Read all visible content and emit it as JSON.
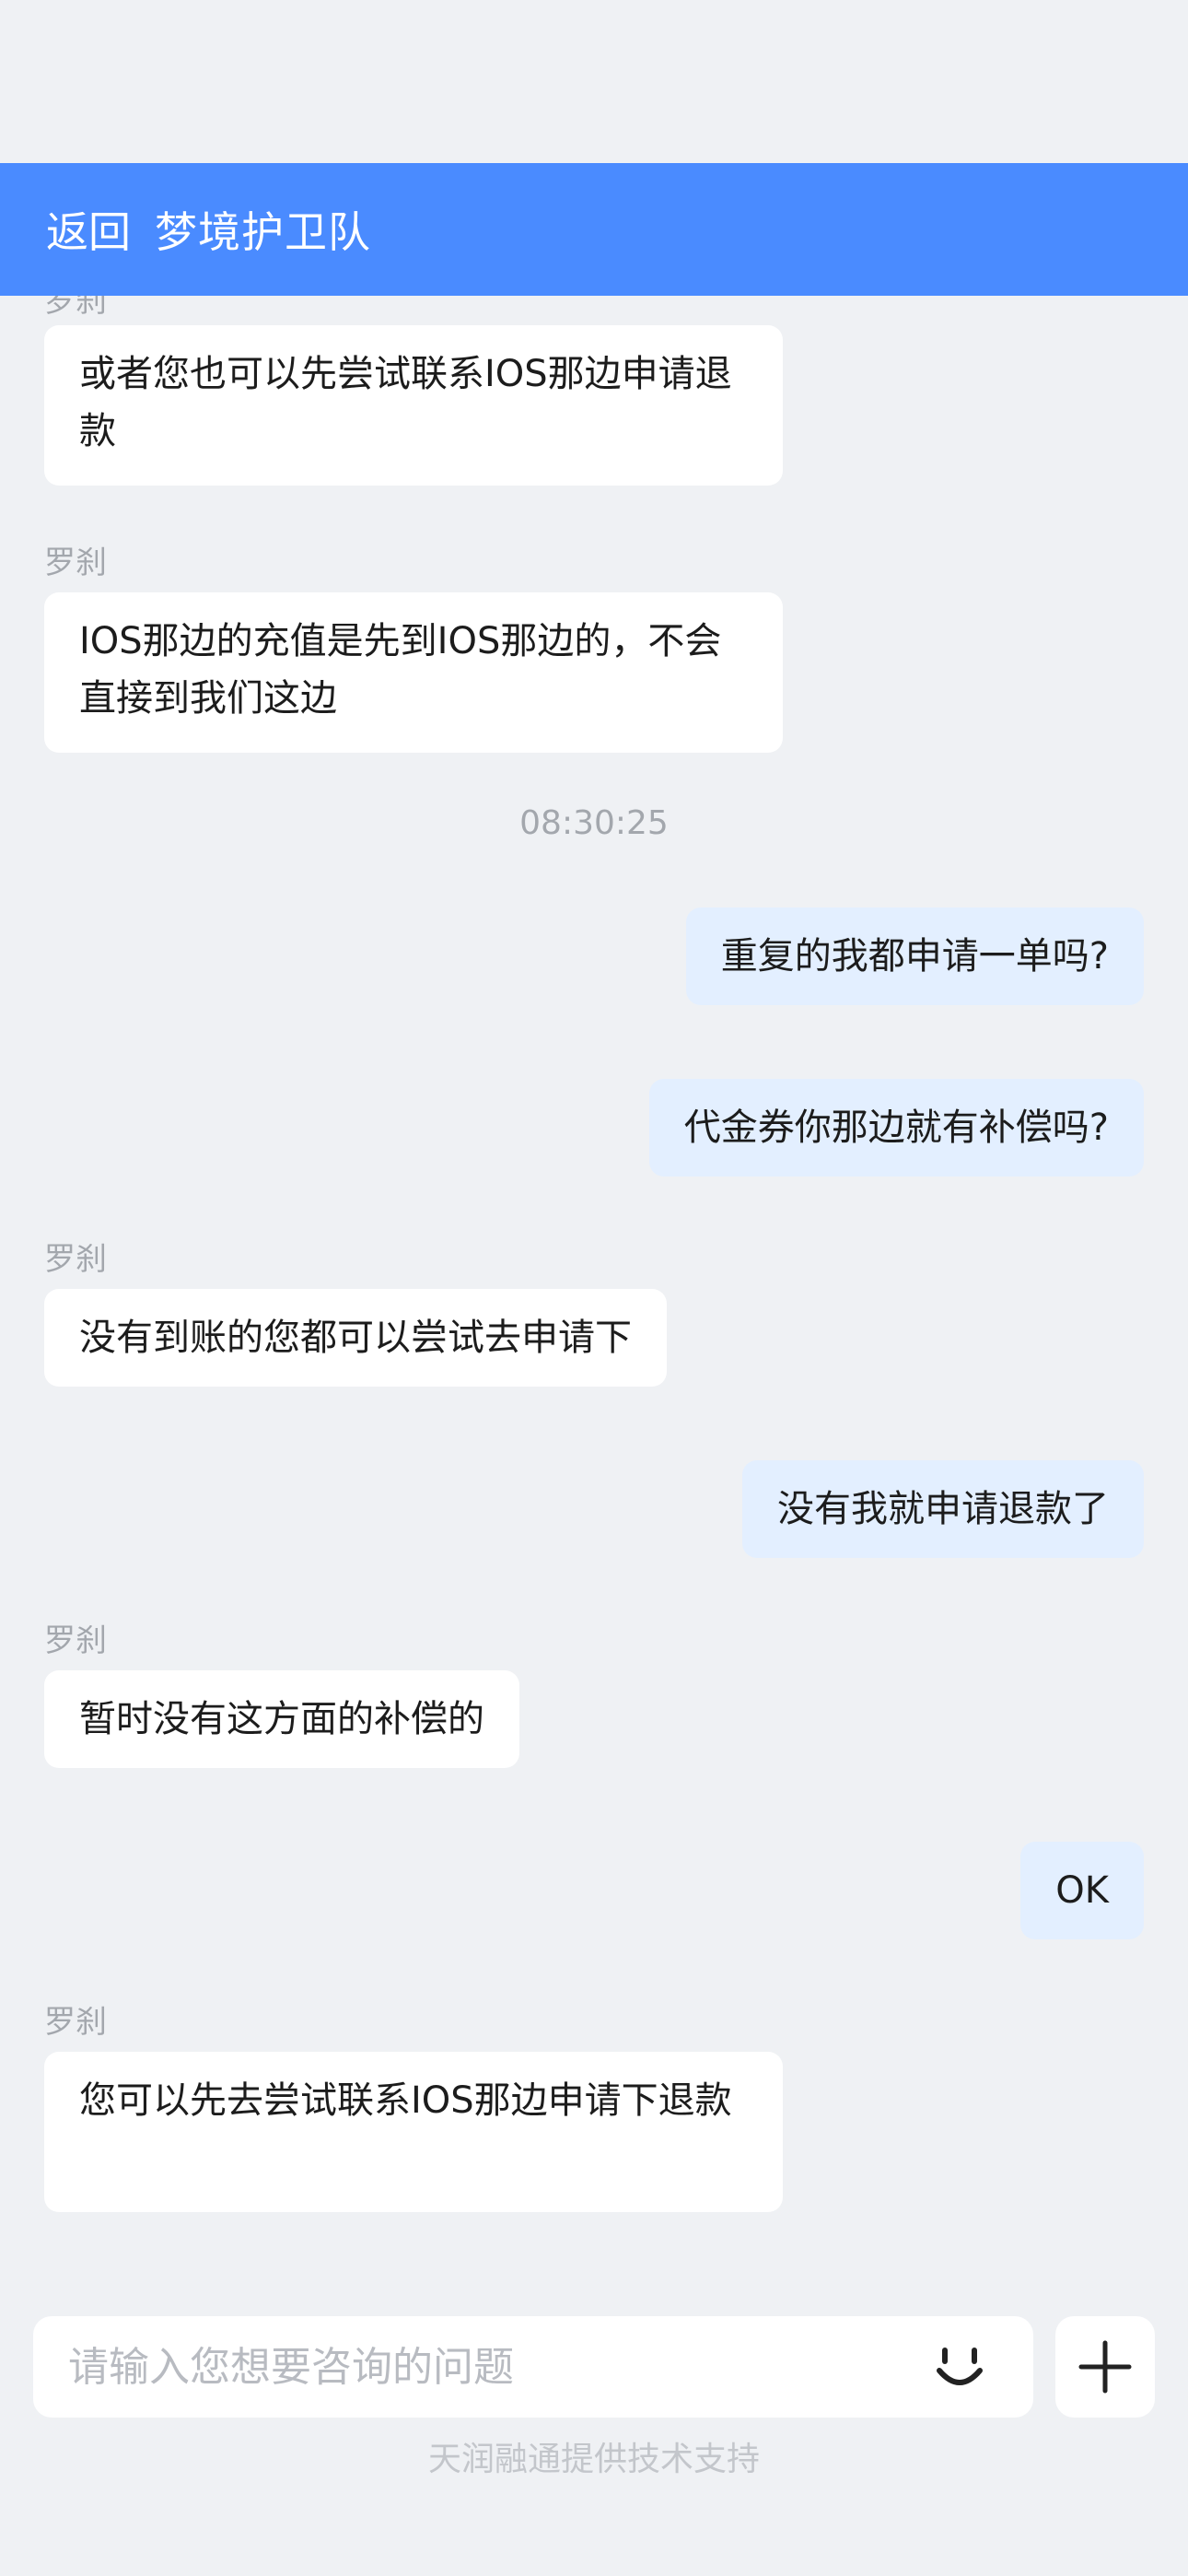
{
  "header": {
    "back_label": "返回",
    "title": "梦境护卫队"
  },
  "messages": [
    {
      "side": "left",
      "sender": "罗刹",
      "text": "或者您也可以先尝试联系IOS那边申请退款"
    },
    {
      "side": "left",
      "sender": "罗刹",
      "text": "IOS那边的充值是先到IOS那边的，不会直接到我们这边"
    },
    {
      "timestamp": "08:30:25"
    },
    {
      "side": "right",
      "text": "重复的我都申请一单吗?"
    },
    {
      "side": "right",
      "text": "代金券你那边就有补偿吗?"
    },
    {
      "side": "left",
      "sender": "罗刹",
      "text": "没有到账的您都可以尝试去申请下"
    },
    {
      "side": "right",
      "text": "没有我就申请退款了"
    },
    {
      "side": "left",
      "sender": "罗刹",
      "text": "暂时没有这方面的补偿的"
    },
    {
      "side": "right",
      "text": "OK"
    },
    {
      "side": "left",
      "sender": "罗刹",
      "text": "您可以先去尝试联系IOS那边申请下退款"
    }
  ],
  "input": {
    "placeholder": "请输入您想要咨询的问题",
    "emoji_icon": "smile-icon",
    "plus_icon": "plus-icon"
  },
  "footer": {
    "note": "天润融通提供技术支持"
  },
  "colors": {
    "header_bg": "#4a8bff",
    "page_bg": "#eff1f4",
    "left_bubble": "#ffffff",
    "right_bubble": "#e3efff"
  }
}
